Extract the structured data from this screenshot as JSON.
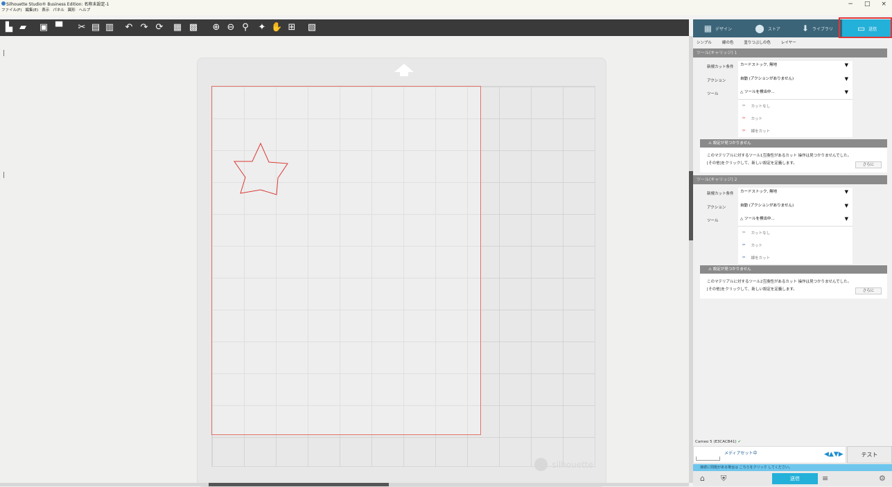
{
  "window": {
    "title": "Silhouette Studio® Business Edition: 名称未設定-1",
    "menus": [
      "ファイル(F)",
      "編集(E)",
      "表示",
      "パネル",
      "図形",
      "ヘルプ"
    ],
    "controls": [
      "−",
      "□",
      "×"
    ]
  },
  "toolbar": {
    "icons": [
      "new-file-icon",
      "open-folder-icon",
      "save-icon",
      "print-icon",
      "cut-icon",
      "copy-icon",
      "paste-icon",
      "undo-icon",
      "redo-icon",
      "refresh-icon",
      "select-icon",
      "deselect-icon",
      "zoom-in-icon",
      "zoom-out-icon",
      "zoom-select-icon",
      "move-icon",
      "pan-icon",
      "fit-icon",
      "pattern-icon"
    ],
    "glyphs": [
      "▙",
      "▰",
      "▣",
      "▀",
      "✂",
      "▤",
      "▥",
      "↶",
      "↷",
      "⟳",
      "▦",
      "▩",
      "⊕",
      "⊖",
      "⚲",
      "✦",
      "✋",
      "⊞",
      "▧"
    ]
  },
  "panel": {
    "tabs": [
      {
        "icon": "design-grid-icon",
        "label": "デザイン",
        "glyph": "▦"
      },
      {
        "icon": "store-s-icon",
        "label": "ストア",
        "glyph": "⬤"
      },
      {
        "icon": "library-down-icon",
        "label": "ライブラリ",
        "glyph": "⬇"
      },
      {
        "icon": "send-machine-icon",
        "label": "送信",
        "glyph": "▭"
      }
    ],
    "subtabs": [
      "シンプル",
      "線の色",
      "塗りつぶしの色",
      "レイヤー"
    ],
    "section1": {
      "title": "ツール(キャリッジ) 1",
      "fields": [
        {
          "label": "新規カット条件",
          "value": "カードストック, 無地"
        },
        {
          "label": "アクション",
          "value": "自動 (アクションがありません)"
        },
        {
          "label": "ツール",
          "value": "ツールを検出中..."
        }
      ],
      "actions": [
        "カットなし",
        "カット",
        "線をカット"
      ],
      "warning_title": "設定が見つかりません",
      "warning_line1": "このマテリアルに対するツール1互換性があるカット 操作は見つかりませんでした。",
      "warning_line2": "[その他]をクリックして、新しい設定を定義します。",
      "more": "さらに"
    },
    "section2": {
      "title": "ツール(キャリッジ) 2",
      "fields": [
        {
          "label": "新規カット条件",
          "value": "カードストック, 無地"
        },
        {
          "label": "アクション",
          "value": "自動 (アクションがありません)"
        },
        {
          "label": "ツール",
          "value": "ツールを検出中..."
        }
      ],
      "actions": [
        "カットなし",
        "カット",
        "線をカット"
      ],
      "warning_title": "設定が見つかりません",
      "warning_line1": "このマテリアルに対するツール2互換性があるカット 操作は見つかりませんでした。",
      "warning_line2": "[その他]をクリックして、新しい設定を定義します。",
      "more": "さらに"
    },
    "device": {
      "name": "Cameo 5 (E3CACB41)",
      "media": "メディアセット中",
      "test": "テスト",
      "info": "接続に問題がある場合は こちらをクリック してください。",
      "send": "送信"
    }
  },
  "mat": {
    "brand": "silhouette"
  },
  "colors": {
    "accent": "#23b0d9",
    "highlight": "#e03636",
    "star": "#d93a34"
  }
}
